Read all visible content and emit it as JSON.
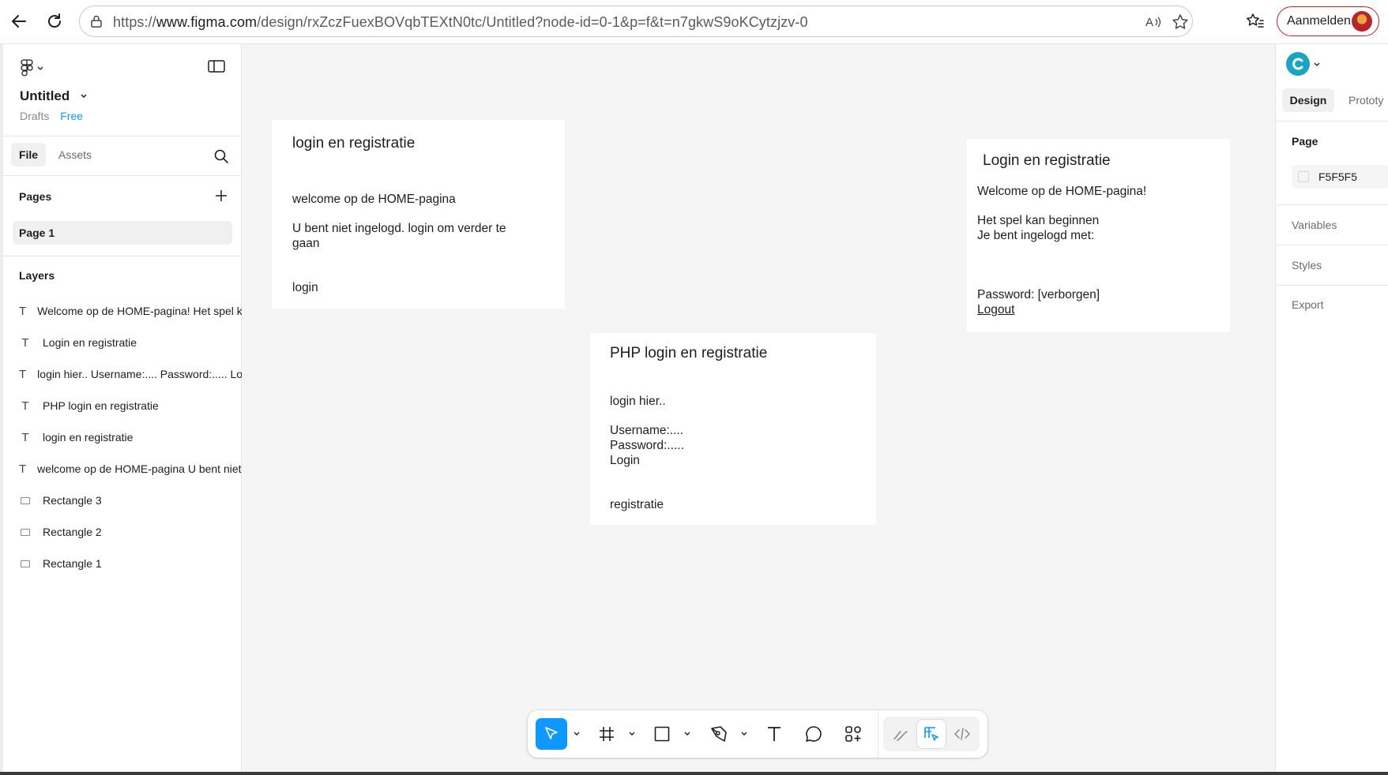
{
  "browser": {
    "url_prefix": "https://",
    "url_host": "www.figma.com",
    "url_path": "/design/rxZczFuexBOVqbTEXtN0tc/Untitled?node-id=0-1&p=f&t=n7gkwS9oKCytzjzv-0",
    "signin_label": "Aanmelden"
  },
  "file": {
    "title": "Untitled",
    "location": "Drafts",
    "plan": "Free"
  },
  "left_tabs": {
    "file": "File",
    "assets": "Assets"
  },
  "pages": {
    "header": "Pages",
    "items": [
      "Page 1"
    ]
  },
  "layers": {
    "header": "Layers",
    "items": [
      {
        "type": "text",
        "name": "Welcome op de HOME-pagina! Het spel kan beginnen Je bent ingelogd met:"
      },
      {
        "type": "text",
        "name": "Login en registratie"
      },
      {
        "type": "text",
        "name": "login hier.. Username:.... Password:..... Login registratie"
      },
      {
        "type": "text",
        "name": "PHP login en registratie"
      },
      {
        "type": "text",
        "name": "login en registratie"
      },
      {
        "type": "text",
        "name": "welcome op de HOME-pagina U bent niet ingelogd. login om verder te gaan login"
      },
      {
        "type": "rect",
        "name": "Rectangle 3"
      },
      {
        "type": "rect",
        "name": "Rectangle 2"
      },
      {
        "type": "rect",
        "name": "Rectangle 1"
      }
    ]
  },
  "frames": {
    "frame1": {
      "title": "login en registratie",
      "line1": "welcome op de HOME-pagina",
      "line2": "U bent niet ingelogd. login om verder te",
      "line3": "gaan",
      "line4": "login"
    },
    "frame2": {
      "title": "PHP login en registratie",
      "line1": "login hier..",
      "line2": "Username:....",
      "line3": "Password:.....",
      "line4": "Login",
      "line5": "registratie"
    },
    "frame3": {
      "title": "Login en registratie",
      "line1": "Welcome op de HOME-pagina!",
      "line2": "Het spel kan beginnen",
      "line3": "Je bent ingelogd met:",
      "line4": "Password: [verborgen]",
      "line5": "Logout"
    }
  },
  "right_panel": {
    "tabs": {
      "design": "Design",
      "prototype": "Prototy"
    },
    "page_header": "Page",
    "page_color": "F5F5F5",
    "variables": "Variables",
    "styles": "Styles",
    "export": "Export"
  },
  "colors": {
    "canvas_bg": "#F5F5F5",
    "accent_blue": "#0D99FF",
    "signin_border": "#C81F2A"
  },
  "toolbar": {
    "tools": [
      "move-tool",
      "frame-tool",
      "rectangle-tool",
      "pen-tool",
      "text-tool",
      "comment-tool",
      "actions-tool",
      "draw-mode",
      "design-mode",
      "dev-mode"
    ],
    "active": "move-tool"
  }
}
